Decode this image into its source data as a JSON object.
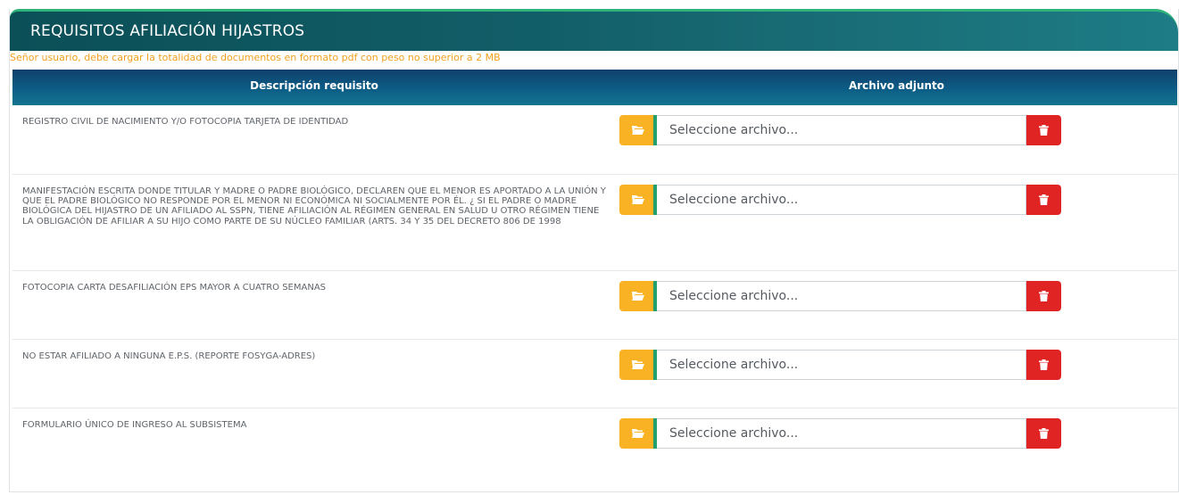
{
  "panel": {
    "title": "REQUISITOS AFILIACIÓN HIJASTROS",
    "notice": "Señor usuario, debe cargar la totalidad de documentos en formato pdf con peso no superior a 2 MB"
  },
  "table": {
    "headers": {
      "description": "Descripción requisito",
      "file": "Archivo adjunto"
    },
    "rows": [
      {
        "description": "REGISTRO CIVIL DE NACIMIENTO Y/O FOTOCOPIA TARJETA DE IDENTIDAD",
        "file_placeholder": "Seleccione archivo..."
      },
      {
        "description": "MANIFESTACIÓN ESCRITA DONDE TITULAR Y MADRE O PADRE BIOLÓGICO, DECLAREN QUE EL MENOR ES APORTADO A LA UNIÓN Y QUE EL PADRE BIOLÓGICO NO RESPONDE POR EL MENOR NI ECONÓMICA NI SOCIALMENTE POR ÉL. ¿ SI EL PADRE O MADRE BIOLÓGICA DEL HIJASTRO DE UN AFILIADO AL SSPN, TIENE AFILIACIÓN AL RÉGIMEN GENERAL EN SALUD U OTRO RÉGIMEN TIENE LA OBLIGACIÓN DE AFILIAR A SU HIJO COMO PARTE DE SU NÚCLEO FAMILIAR (ARTS. 34 Y 35 DEL DECRETO 806 DE 1998",
        "file_placeholder": "Seleccione archivo..."
      },
      {
        "description": "FOTOCOPIA CARTA DESAFILIACIÓN EPS MAYOR A CUATRO SEMANAS",
        "file_placeholder": "Seleccione archivo..."
      },
      {
        "description": "NO ESTAR AFILIADO A NINGUNA E.P.S. (REPORTE FOSYGA-ADRES)",
        "file_placeholder": "Seleccione archivo..."
      },
      {
        "description": "FORMULARIO ÚNICO DE INGRESO AL SUBSISTEMA",
        "file_placeholder": "Seleccione archivo..."
      }
    ]
  },
  "icons": {
    "browse": "folder-open-icon",
    "delete": "trash-icon"
  },
  "colors": {
    "header_bg": "#125e68",
    "header_accent": "#2fb37a",
    "table_head_bg": "#0c5d86",
    "notice_text": "#f2a01f",
    "browse_button": "#f9b224",
    "delete_button": "#e02424"
  }
}
